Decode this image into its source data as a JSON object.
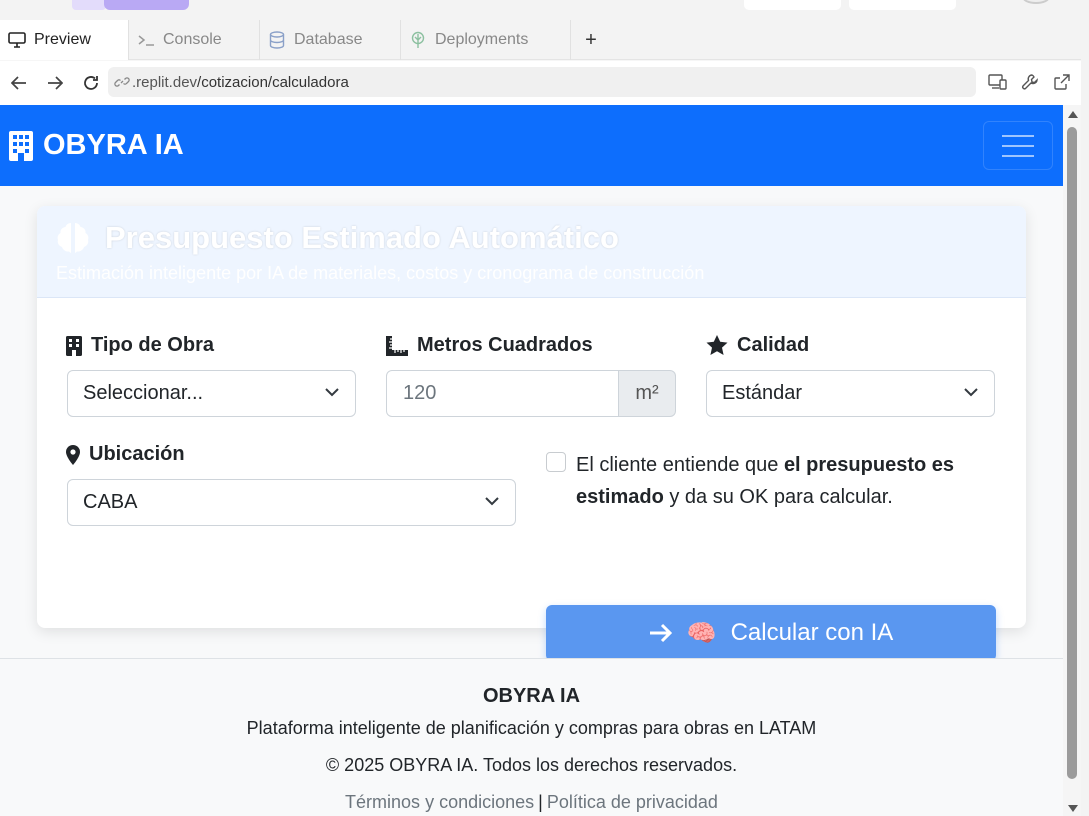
{
  "browser": {
    "tabs": [
      {
        "label": "Preview",
        "icon": "monitor-icon",
        "active": true
      },
      {
        "label": "Console",
        "icon": "terminal-icon",
        "active": false
      },
      {
        "label": "Database",
        "icon": "database-icon",
        "active": false
      },
      {
        "label": "Deployments",
        "icon": "deploy-icon",
        "active": false
      }
    ],
    "add_tab": "+",
    "url_host": ".replit.dev",
    "url_path": "/cotizacion/calculadora"
  },
  "navbar": {
    "brand": "OBYRA IA",
    "brand_color": "#0d6efd"
  },
  "card": {
    "title": "Presupuesto Estimado Automático",
    "subtitle": "Estimación inteligente por IA de materiales, costos y cronograma de construcción",
    "fields": {
      "tipo_label": "Tipo de Obra",
      "tipo_value": "Seleccionar...",
      "metros_label": "Metros Cuadrados",
      "metros_placeholder": "120",
      "metros_unit": "m²",
      "calidad_label": "Calidad",
      "calidad_value": "Estándar",
      "ubicacion_label": "Ubicación",
      "ubicacion_value": "CABA"
    },
    "consent": {
      "text_before": "El cliente entiende que ",
      "text_bold": "el presupuesto es estimado",
      "text_after": " y da su OK para calcular.",
      "checked": false
    },
    "button": {
      "emoji": "🧠",
      "label": "Calcular con IA",
      "color": "#5a97f0"
    }
  },
  "footer": {
    "brand": "OBYRA IA",
    "tagline": "Plataforma inteligente de planificación y compras para obras en LATAM",
    "copyright": "© 2025 OBYRA IA. Todos los derechos reservados.",
    "terms": "Términos y condiciones",
    "separator": "|",
    "privacy": "Política de privacidad"
  }
}
